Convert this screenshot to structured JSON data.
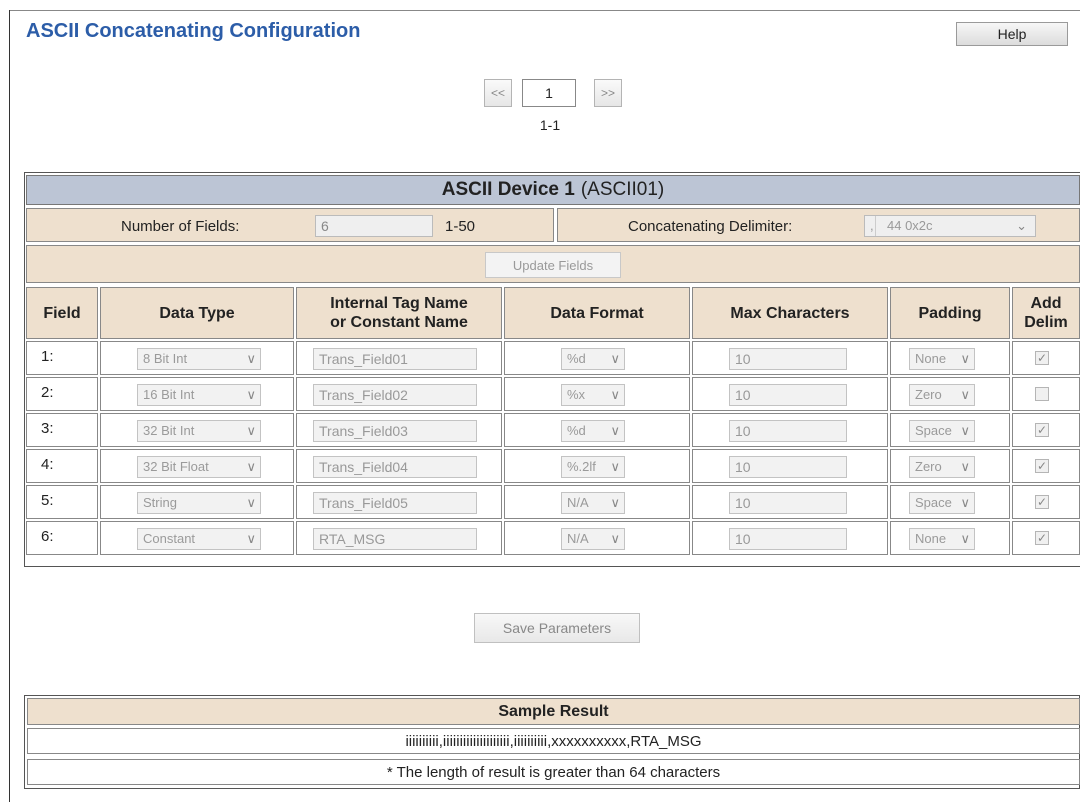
{
  "page": {
    "title": "ASCII Concatenating Configuration",
    "help_label": "Help"
  },
  "pager": {
    "prev_label": "<<",
    "current": "1",
    "next_label": ">>",
    "range": "1-1"
  },
  "device": {
    "name": "ASCII Device 1",
    "tag": "(ASCII01)",
    "num_fields_label": "Number of Fields:",
    "num_fields_value": "6",
    "num_fields_range": "1-50",
    "delimiter_label": "Concatenating Delimiter:",
    "delimiter_char": ",",
    "delimiter_value": "44  0x2c",
    "update_label": "Update Fields"
  },
  "table": {
    "headers": {
      "field": "Field",
      "data_type": "Data Type",
      "tag_name_1": "Internal Tag Name",
      "tag_name_2": "or Constant Name",
      "data_format": "Data Format",
      "max_chars": "Max Characters",
      "padding": "Padding",
      "add_1": "Add",
      "add_2": "Delim"
    },
    "rows": [
      {
        "field": "1:",
        "data_type": "8 Bit Int",
        "tag": "Trans_Field01",
        "format": "%d",
        "max": "10",
        "padding": "None",
        "delim": true
      },
      {
        "field": "2:",
        "data_type": "16 Bit Int",
        "tag": "Trans_Field02",
        "format": "%x",
        "max": "10",
        "padding": "Zero",
        "delim": false
      },
      {
        "field": "3:",
        "data_type": "32 Bit Int",
        "tag": "Trans_Field03",
        "format": "%d",
        "max": "10",
        "padding": "Space",
        "delim": true
      },
      {
        "field": "4:",
        "data_type": "32 Bit Float",
        "tag": "Trans_Field04",
        "format": "%.2lf",
        "max": "10",
        "padding": "Zero",
        "delim": true
      },
      {
        "field": "5:",
        "data_type": "String",
        "tag": "Trans_Field05",
        "format": "N/A",
        "max": "10",
        "padding": "Space",
        "delim": true
      },
      {
        "field": "6:",
        "data_type": "Constant",
        "tag": "RTA_MSG",
        "format": "N/A",
        "max": "10",
        "padding": "None",
        "delim": true
      }
    ]
  },
  "save_label": "Save Parameters",
  "sample": {
    "header": "Sample Result",
    "result": "iiiiiiiiii,iiiiiiiiiiiiiiiiiiii,iiiiiiiiii,xxxxxxxxxx,RTA_MSG",
    "note": "* The length of result is greater than 64 characters"
  }
}
